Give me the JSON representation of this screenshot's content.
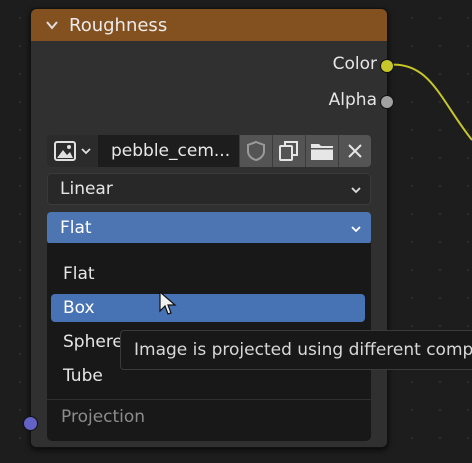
{
  "node": {
    "title": "Roughness",
    "outputs": [
      {
        "label": "Color",
        "color": "#c7c729"
      },
      {
        "label": "Alpha",
        "color": "#a1a1a1"
      }
    ],
    "image_name": "pebble_cem...",
    "interpolation": "Linear",
    "projection_selected": "Flat"
  },
  "menu": {
    "items": [
      {
        "label": "Flat"
      },
      {
        "label": "Box"
      },
      {
        "label": "Sphere"
      },
      {
        "label": "Tube"
      }
    ],
    "title": "Projection",
    "highlighted": "Box"
  },
  "tooltip": {
    "text": "Image is projected using different comp"
  },
  "colors": {
    "header": "#83501f",
    "highlight": "#4772b3",
    "input_socket": "#6363c7",
    "link": "#c7c729"
  }
}
